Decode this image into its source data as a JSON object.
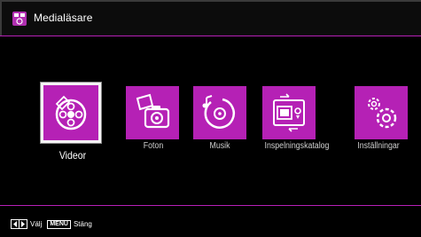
{
  "header": {
    "title": "Medialäsare"
  },
  "tiles": [
    {
      "label": "Videor",
      "icon": "film-reel-icon"
    },
    {
      "label": "Foton",
      "icon": "camera-photo-icon"
    },
    {
      "label": "Musik",
      "icon": "music-disc-icon"
    },
    {
      "label": "Inspelningskatalog",
      "icon": "recording-library-icon"
    },
    {
      "label": "Inställningar",
      "icon": "settings-gears-icon"
    }
  ],
  "selected_index": 0,
  "footer": {
    "nav_label": "Välj",
    "menu_key": "MENU",
    "menu_label": "Stäng"
  },
  "colors": {
    "accent": "#b521b5",
    "background": "#000000",
    "text": "#ffffff"
  }
}
